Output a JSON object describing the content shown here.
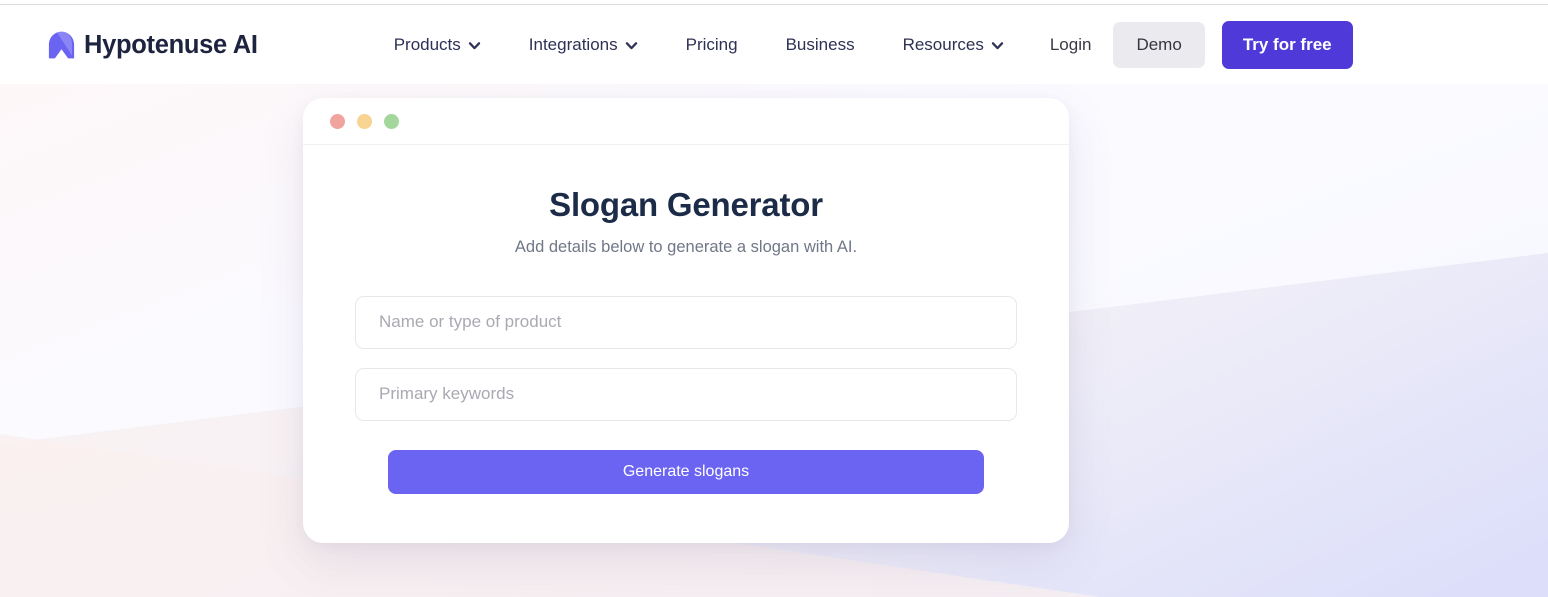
{
  "brand": {
    "name": "Hypotenuse AI",
    "logo_icon": "hypotenuse-arch-logo",
    "logo_color": "#6b63f2"
  },
  "nav": {
    "items": [
      {
        "label": "Products",
        "has_dropdown": true,
        "icon": "chevron-down-icon"
      },
      {
        "label": "Integrations",
        "has_dropdown": true,
        "icon": "chevron-down-icon"
      },
      {
        "label": "Pricing",
        "has_dropdown": false
      },
      {
        "label": "Business",
        "has_dropdown": false
      },
      {
        "label": "Resources",
        "has_dropdown": true,
        "icon": "chevron-down-icon"
      }
    ],
    "login_label": "Login",
    "demo_label": "Demo",
    "try_label": "Try for free",
    "try_color": "#4f39d9",
    "demo_bg": "#ebebef"
  },
  "card": {
    "window_dots": [
      {
        "name": "close-dot",
        "color": "#f1a3a0"
      },
      {
        "name": "minimize-dot",
        "color": "#f7d491"
      },
      {
        "name": "maximize-dot",
        "color": "#a4d79c"
      }
    ],
    "title": "Slogan Generator",
    "subtitle": "Add details below to generate a slogan with AI.",
    "fields": [
      {
        "name": "product-name-input",
        "placeholder": "Name or type of product",
        "value": ""
      },
      {
        "name": "primary-keywords-input",
        "placeholder": "Primary keywords",
        "value": ""
      }
    ],
    "submit_label": "Generate slogans",
    "submit_color": "#6b63f2"
  },
  "background": {
    "pink": "#f9eff0",
    "lavender": "#dfe0f7",
    "white_wedge": "#fbfbfe"
  }
}
